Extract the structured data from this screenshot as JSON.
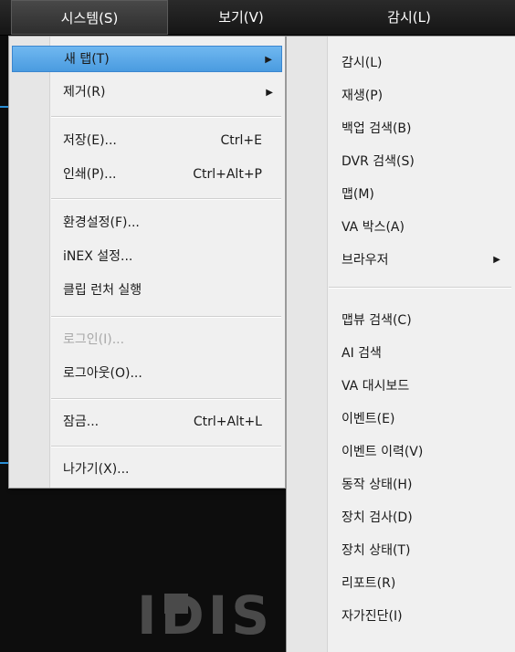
{
  "menubar": {
    "system": "시스템(S)",
    "view": "보기(V)",
    "monitor": "감시(L)"
  },
  "system_menu": {
    "new_tab": "새 탭(T)",
    "remove": "제거(R)",
    "save": "저장(E)...",
    "save_shortcut": "Ctrl+E",
    "print": "인쇄(P)...",
    "print_shortcut": "Ctrl+Alt+P",
    "settings": "환경설정(F)...",
    "inex_settings": "iNEX 설정...",
    "clip_launcher": "클립 런처 실행",
    "login": "로그인(I)...",
    "logout": "로그아웃(O)...",
    "lock": "잠금...",
    "lock_shortcut": "Ctrl+Alt+L",
    "exit": "나가기(X)..."
  },
  "new_tab_submenu": {
    "items": [
      "감시(L)",
      "재생(P)",
      "백업 검색(B)",
      "DVR 검색(S)",
      "맵(M)",
      "VA 박스(A)",
      "브라우저",
      "맵뷰 검색(C)",
      "AI 검색",
      "VA 대시보드",
      "이벤트(E)",
      "이벤트 이력(V)",
      "동작 상태(H)",
      "장치 검사(D)",
      "장치 상태(T)",
      "리포트(R)",
      "자가진단(I)"
    ]
  },
  "background": {
    "logo_text": "IDIS"
  },
  "colors": {
    "highlight": "#4a9be0",
    "menubar": "#1c1c1c",
    "menu_bg": "#f0f0f0"
  }
}
